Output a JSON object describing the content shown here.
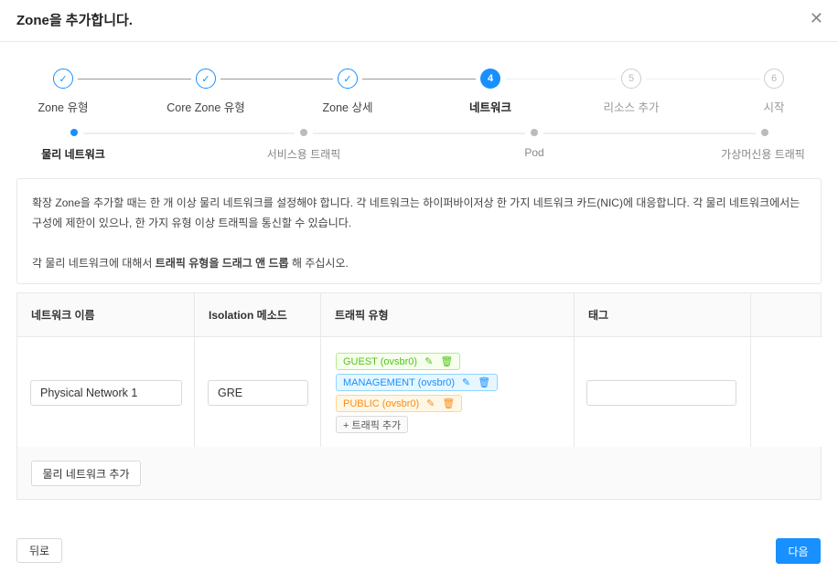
{
  "dialog": {
    "title": "Zone을 추가합니다.",
    "close_icon": "close-icon"
  },
  "steps": [
    {
      "label": "Zone 유형",
      "status": "done",
      "number": "1"
    },
    {
      "label": "Core Zone 유형",
      "status": "done",
      "number": "2"
    },
    {
      "label": "Zone 상세",
      "status": "done",
      "number": "3"
    },
    {
      "label": "네트워크",
      "status": "current",
      "number": "4"
    },
    {
      "label": "리소스 추가",
      "status": "todo",
      "number": "5"
    },
    {
      "label": "시작",
      "status": "todo",
      "number": "6"
    }
  ],
  "substeps": [
    {
      "label": "물리 네트워크",
      "status": "current"
    },
    {
      "label": "서비스용 트래픽",
      "status": "todo"
    },
    {
      "label": "Pod",
      "status": "todo"
    },
    {
      "label": "가상머신용 트래픽",
      "status": "todo"
    }
  ],
  "info": {
    "para1": "확장 Zone을 추가할 때는 한 개 이상 물리 네트워크를 설정해야 합니다. 각 네트워크는 하이퍼바이저상 한 가지 네트워크 카드(NIC)에 대응합니다. 각 물리 네트워크에서는 구성에 제한이 있으나, 한 가지 유형 이상 트래픽을 통신할 수 있습니다.",
    "para2_prefix": "각 물리 네트워크에 대해서 ",
    "para2_bold": "트래픽 유형을 드래그 앤 드롭",
    "para2_suffix": " 해 주십시오."
  },
  "table": {
    "headers": [
      "네트워크 이름",
      "Isolation 메소드",
      "트래픽 유형",
      "태그"
    ],
    "row": {
      "network_name": "Physical Network 1",
      "isolation": "GRE",
      "tag": "",
      "traffic": [
        {
          "label": "GUEST (ovsbr0)",
          "color": "#52c41a"
        },
        {
          "label": "MANAGEMENT (ovsbr0)",
          "color": "#1890ff"
        },
        {
          "label": "PUBLIC (ovsbr0)",
          "color": "#fa8c16"
        }
      ],
      "add_traffic": "+ 트래픽 추가"
    },
    "add_network": "물리 네트워크 추가"
  },
  "footer": {
    "back": "뒤로",
    "next": "다음"
  },
  "colors": {
    "accent": "#1890ff"
  }
}
